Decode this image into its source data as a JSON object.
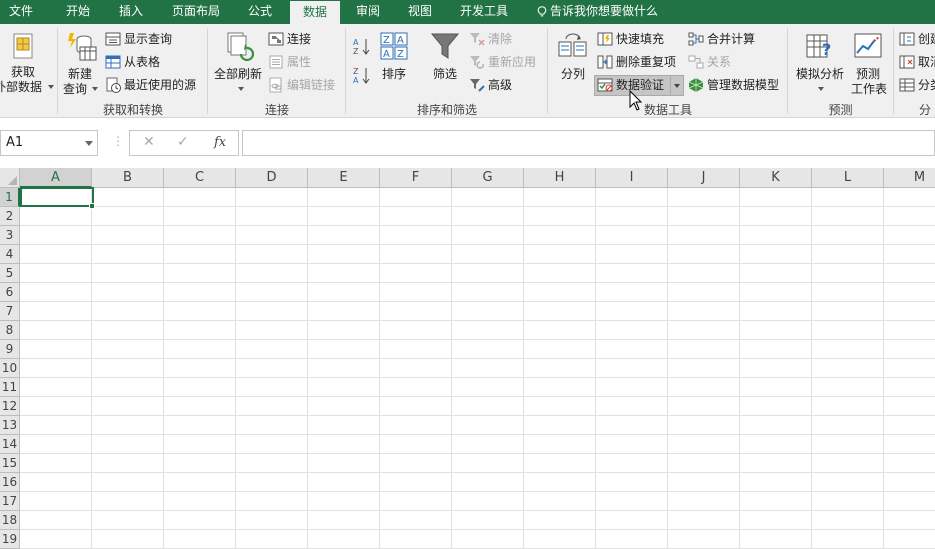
{
  "tabs": {
    "file": "文件",
    "home": "开始",
    "insert": "插入",
    "page_layout": "页面布局",
    "formulas": "公式",
    "data": "数据",
    "review": "审阅",
    "view": "视图",
    "developer": "开发工具",
    "tell_me": "告诉我你想要做什么"
  },
  "ribbon": {
    "get_external": {
      "line1": "获取",
      "line2": "外部数据"
    },
    "get_transform": {
      "new_query_line1": "新建",
      "new_query_line2": "查询",
      "show_queries": "显示查询",
      "from_table": "从表格",
      "recent_sources": "最近使用的源",
      "group_label": "获取和转换"
    },
    "connections": {
      "refresh_all": "全部刷新",
      "connections": "连接",
      "properties": "属性",
      "edit_links": "编辑链接",
      "group_label": "连接"
    },
    "sort_filter": {
      "sort": "排序",
      "filter": "筛选",
      "clear": "清除",
      "reapply": "重新应用",
      "advanced": "高级",
      "group_label": "排序和筛选"
    },
    "data_tools": {
      "text_to_columns": "分列",
      "flash_fill": "快速填充",
      "remove_duplicates": "删除重复项",
      "data_validation": "数据验证",
      "consolidate": "合并计算",
      "relationships": "关系",
      "manage_data_model": "管理数据模型",
      "group_label": "数据工具"
    },
    "forecast": {
      "what_if": "模拟分析",
      "forecast_line1": "预测",
      "forecast_line2": "工作表",
      "group_label": "预测"
    },
    "outline": {
      "group": "创建",
      "ungroup": "取消",
      "subtotal": "分类",
      "group_label": "分"
    }
  },
  "formula_bar": {
    "name_box": "A1",
    "cancel": "✕",
    "enter": "✓",
    "fx": "fx",
    "content": ""
  },
  "grid": {
    "columns": [
      "A",
      "B",
      "C",
      "D",
      "E",
      "F",
      "G",
      "H",
      "I",
      "J",
      "K",
      "L",
      "M"
    ],
    "rows": [
      "1",
      "2",
      "3",
      "4",
      "5",
      "6",
      "7",
      "8",
      "9",
      "10",
      "11",
      "12",
      "13",
      "14",
      "15",
      "16",
      "17",
      "18",
      "19"
    ],
    "active_cell": "A1"
  },
  "colors": {
    "accent": "#217346",
    "ribbon_bg": "#f0f0f0",
    "header_bg": "#e6e6e6",
    "gridline": "#e1e1e1"
  }
}
